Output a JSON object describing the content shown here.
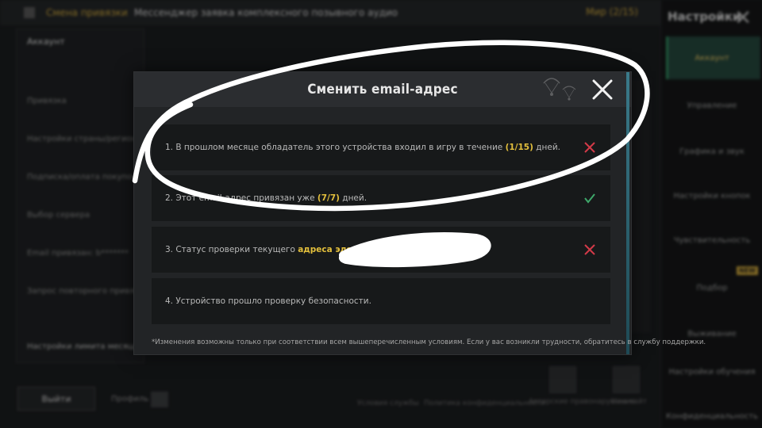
{
  "background": {
    "topbar": {
      "highlight": "Смена привязки",
      "text": "Мессенджер заявка комплексного позывного аудио",
      "page": "Мир (2/15)"
    },
    "left_panel": {
      "heading": "Аккаунт",
      "rows": [
        "Привязка",
        "Настройки страны/региона",
        "Подписка/оплата покупок",
        "Выбор сервера",
        "Email привязан: b*******",
        "Запрос повторного привязки",
        "Настройки лимита месяца"
      ]
    },
    "bottom": {
      "exit_label": "Выйти",
      "tray_label": "Профиль",
      "dim_items": [
        "Условия службы",
        "Политика конфиденциальности",
        "Авторские правонарушения",
        "Наш сайт"
      ]
    },
    "sidebar": {
      "title": "Настройки",
      "items": [
        "Аккаунт",
        "Управление",
        "Графика и звук",
        "Настройки кнопок",
        "Чувствительность",
        "Подбор",
        "Выживание",
        "Настройки обучения",
        "Конфиденциальность"
      ],
      "new_badge": "NEW"
    }
  },
  "modal": {
    "title": "Сменить email-адрес",
    "conditions": [
      {
        "before": "1. В прошлом месяце обладатель этого устройства входил в игру в течение ",
        "highlight": "(1/15)",
        "after": " дней.",
        "status": "fail"
      },
      {
        "before": "2. Этот email-адрес привязан уже ",
        "highlight": "(7/7)",
        "after": " дней.",
        "status": "ok"
      },
      {
        "before": "3. Статус проверки текущего ",
        "highlight": "адреса электронной п",
        "after": "",
        "status": "fail"
      },
      {
        "before": "4. Устройство прошло проверку безопасности.",
        "highlight": "",
        "after": "",
        "status": "none"
      }
    ],
    "footnote": "*Изменения возможны только при соответствии всем вышеперечисленным условиям. Если у вас возникли трудности, обратитесь в службу поддержки."
  },
  "colors": {
    "highlight": "#e3bf3c",
    "fail": "#d23a48",
    "ok": "#3ea86a",
    "annotation": "#ffffff"
  },
  "icons": {
    "close": "close-icon",
    "fail": "cross-icon",
    "ok": "check-icon"
  }
}
